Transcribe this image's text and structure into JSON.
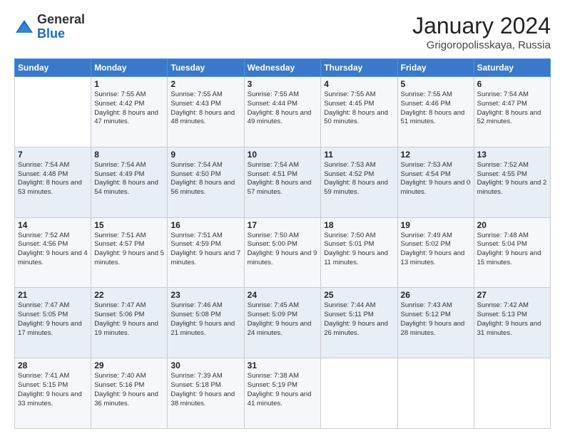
{
  "header": {
    "logo_general": "General",
    "logo_blue": "Blue",
    "month_title": "January 2024",
    "location": "Grigoropolisskaya, Russia"
  },
  "weekdays": [
    "Sunday",
    "Monday",
    "Tuesday",
    "Wednesday",
    "Thursday",
    "Friday",
    "Saturday"
  ],
  "weeks": [
    [
      {
        "day": "",
        "sunrise": "",
        "sunset": "",
        "daylight": ""
      },
      {
        "day": "1",
        "sunrise": "Sunrise: 7:55 AM",
        "sunset": "Sunset: 4:42 PM",
        "daylight": "Daylight: 8 hours and 47 minutes."
      },
      {
        "day": "2",
        "sunrise": "Sunrise: 7:55 AM",
        "sunset": "Sunset: 4:43 PM",
        "daylight": "Daylight: 8 hours and 48 minutes."
      },
      {
        "day": "3",
        "sunrise": "Sunrise: 7:55 AM",
        "sunset": "Sunset: 4:44 PM",
        "daylight": "Daylight: 8 hours and 49 minutes."
      },
      {
        "day": "4",
        "sunrise": "Sunrise: 7:55 AM",
        "sunset": "Sunset: 4:45 PM",
        "daylight": "Daylight: 8 hours and 50 minutes."
      },
      {
        "day": "5",
        "sunrise": "Sunrise: 7:55 AM",
        "sunset": "Sunset: 4:46 PM",
        "daylight": "Daylight: 8 hours and 51 minutes."
      },
      {
        "day": "6",
        "sunrise": "Sunrise: 7:54 AM",
        "sunset": "Sunset: 4:47 PM",
        "daylight": "Daylight: 8 hours and 52 minutes."
      }
    ],
    [
      {
        "day": "7",
        "sunrise": "Sunrise: 7:54 AM",
        "sunset": "Sunset: 4:48 PM",
        "daylight": "Daylight: 8 hours and 53 minutes."
      },
      {
        "day": "8",
        "sunrise": "Sunrise: 7:54 AM",
        "sunset": "Sunset: 4:49 PM",
        "daylight": "Daylight: 8 hours and 54 minutes."
      },
      {
        "day": "9",
        "sunrise": "Sunrise: 7:54 AM",
        "sunset": "Sunset: 4:50 PM",
        "daylight": "Daylight: 8 hours and 56 minutes."
      },
      {
        "day": "10",
        "sunrise": "Sunrise: 7:54 AM",
        "sunset": "Sunset: 4:51 PM",
        "daylight": "Daylight: 8 hours and 57 minutes."
      },
      {
        "day": "11",
        "sunrise": "Sunrise: 7:53 AM",
        "sunset": "Sunset: 4:52 PM",
        "daylight": "Daylight: 8 hours and 59 minutes."
      },
      {
        "day": "12",
        "sunrise": "Sunrise: 7:53 AM",
        "sunset": "Sunset: 4:54 PM",
        "daylight": "Daylight: 9 hours and 0 minutes."
      },
      {
        "day": "13",
        "sunrise": "Sunrise: 7:52 AM",
        "sunset": "Sunset: 4:55 PM",
        "daylight": "Daylight: 9 hours and 2 minutes."
      }
    ],
    [
      {
        "day": "14",
        "sunrise": "Sunrise: 7:52 AM",
        "sunset": "Sunset: 4:56 PM",
        "daylight": "Daylight: 9 hours and 4 minutes."
      },
      {
        "day": "15",
        "sunrise": "Sunrise: 7:51 AM",
        "sunset": "Sunset: 4:57 PM",
        "daylight": "Daylight: 9 hours and 5 minutes."
      },
      {
        "day": "16",
        "sunrise": "Sunrise: 7:51 AM",
        "sunset": "Sunset: 4:59 PM",
        "daylight": "Daylight: 9 hours and 7 minutes."
      },
      {
        "day": "17",
        "sunrise": "Sunrise: 7:50 AM",
        "sunset": "Sunset: 5:00 PM",
        "daylight": "Daylight: 9 hours and 9 minutes."
      },
      {
        "day": "18",
        "sunrise": "Sunrise: 7:50 AM",
        "sunset": "Sunset: 5:01 PM",
        "daylight": "Daylight: 9 hours and 11 minutes."
      },
      {
        "day": "19",
        "sunrise": "Sunrise: 7:49 AM",
        "sunset": "Sunset: 5:02 PM",
        "daylight": "Daylight: 9 hours and 13 minutes."
      },
      {
        "day": "20",
        "sunrise": "Sunrise: 7:48 AM",
        "sunset": "Sunset: 5:04 PM",
        "daylight": "Daylight: 9 hours and 15 minutes."
      }
    ],
    [
      {
        "day": "21",
        "sunrise": "Sunrise: 7:47 AM",
        "sunset": "Sunset: 5:05 PM",
        "daylight": "Daylight: 9 hours and 17 minutes."
      },
      {
        "day": "22",
        "sunrise": "Sunrise: 7:47 AM",
        "sunset": "Sunset: 5:06 PM",
        "daylight": "Daylight: 9 hours and 19 minutes."
      },
      {
        "day": "23",
        "sunrise": "Sunrise: 7:46 AM",
        "sunset": "Sunset: 5:08 PM",
        "daylight": "Daylight: 9 hours and 21 minutes."
      },
      {
        "day": "24",
        "sunrise": "Sunrise: 7:45 AM",
        "sunset": "Sunset: 5:09 PM",
        "daylight": "Daylight: 9 hours and 24 minutes."
      },
      {
        "day": "25",
        "sunrise": "Sunrise: 7:44 AM",
        "sunset": "Sunset: 5:11 PM",
        "daylight": "Daylight: 9 hours and 26 minutes."
      },
      {
        "day": "26",
        "sunrise": "Sunrise: 7:43 AM",
        "sunset": "Sunset: 5:12 PM",
        "daylight": "Daylight: 9 hours and 28 minutes."
      },
      {
        "day": "27",
        "sunrise": "Sunrise: 7:42 AM",
        "sunset": "Sunset: 5:13 PM",
        "daylight": "Daylight: 9 hours and 31 minutes."
      }
    ],
    [
      {
        "day": "28",
        "sunrise": "Sunrise: 7:41 AM",
        "sunset": "Sunset: 5:15 PM",
        "daylight": "Daylight: 9 hours and 33 minutes."
      },
      {
        "day": "29",
        "sunrise": "Sunrise: 7:40 AM",
        "sunset": "Sunset: 5:16 PM",
        "daylight": "Daylight: 9 hours and 36 minutes."
      },
      {
        "day": "30",
        "sunrise": "Sunrise: 7:39 AM",
        "sunset": "Sunset: 5:18 PM",
        "daylight": "Daylight: 9 hours and 38 minutes."
      },
      {
        "day": "31",
        "sunrise": "Sunrise: 7:38 AM",
        "sunset": "Sunset: 5:19 PM",
        "daylight": "Daylight: 9 hours and 41 minutes."
      },
      {
        "day": "",
        "sunrise": "",
        "sunset": "",
        "daylight": ""
      },
      {
        "day": "",
        "sunrise": "",
        "sunset": "",
        "daylight": ""
      },
      {
        "day": "",
        "sunrise": "",
        "sunset": "",
        "daylight": ""
      }
    ]
  ]
}
